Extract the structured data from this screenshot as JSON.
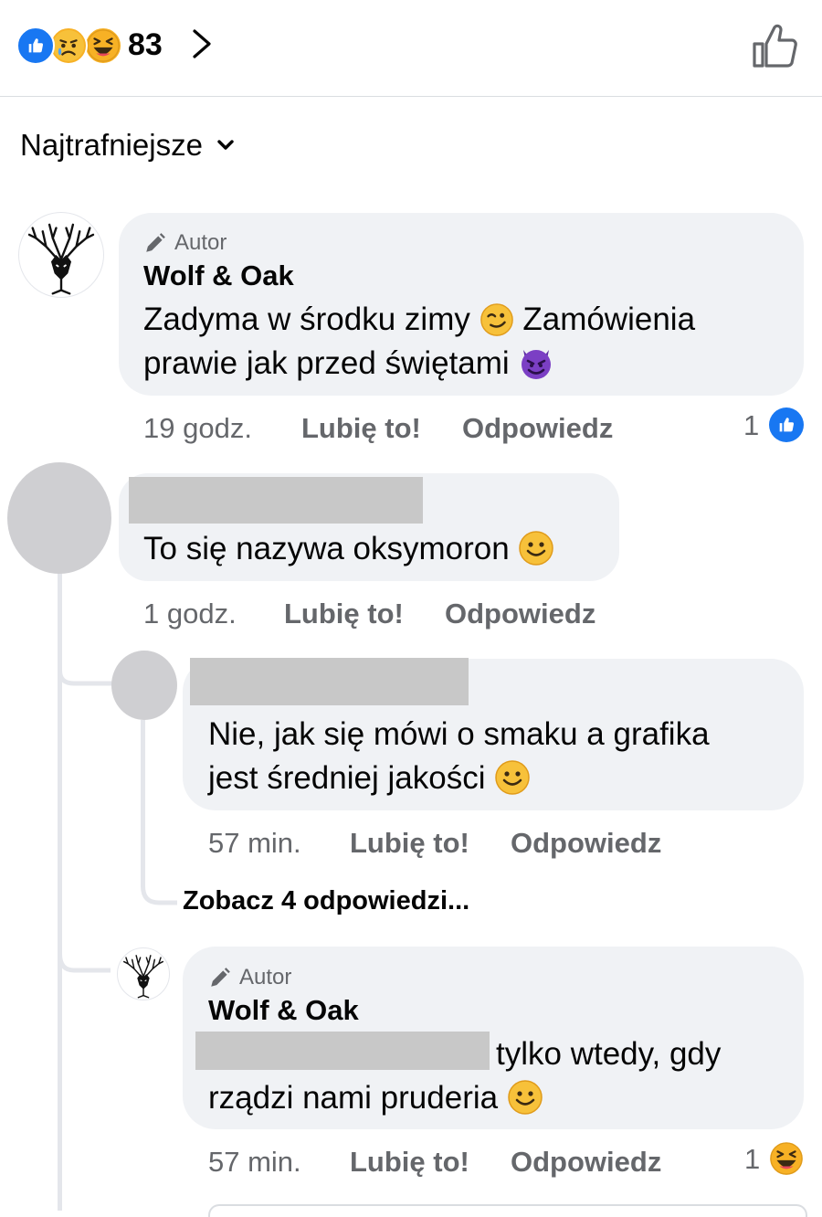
{
  "reactions": {
    "count": "83",
    "icons": [
      "like-icon",
      "sad-icon",
      "haha-icon"
    ]
  },
  "sort": {
    "label": "Najtrafniejsze"
  },
  "comments": [
    {
      "author_badge": "Autor",
      "author": "Wolf & Oak",
      "text_a": "Zadyma w środku zimy",
      "text_b": "Zamówienia",
      "text_c": "prawie jak przed świętami",
      "time": "19 godz.",
      "like": "Lubię to!",
      "reply": "Odpowiedz",
      "reaction_count": "1"
    },
    {
      "text": "To się nazywa oksymoron",
      "time": "1 godz.",
      "like": "Lubię to!",
      "reply": "Odpowiedz"
    }
  ],
  "replies": [
    {
      "text_line1": "Nie, jak się  mówi o smaku a grafika",
      "text_line2": "jest średniej jakości",
      "time": "57 min.",
      "like": "Lubię to!",
      "reply": "Odpowiedz"
    },
    {
      "author_badge": "Autor",
      "author": "Wolf & Oak",
      "text_line1": "tylko wtedy, gdy",
      "text_line2": "rządzi nami pruderia",
      "time": "57 min.",
      "like": "Lubię to!",
      "reply": "Odpowiedz",
      "reaction_count": "1"
    }
  ],
  "see_replies": "Zobacz 4 odpowiedzi...",
  "colors": {
    "accent": "#1877f2",
    "bubble": "#f0f2f5",
    "muted": "#65676b",
    "emoji": "#f7b125",
    "devil": "#7b3fc4"
  }
}
